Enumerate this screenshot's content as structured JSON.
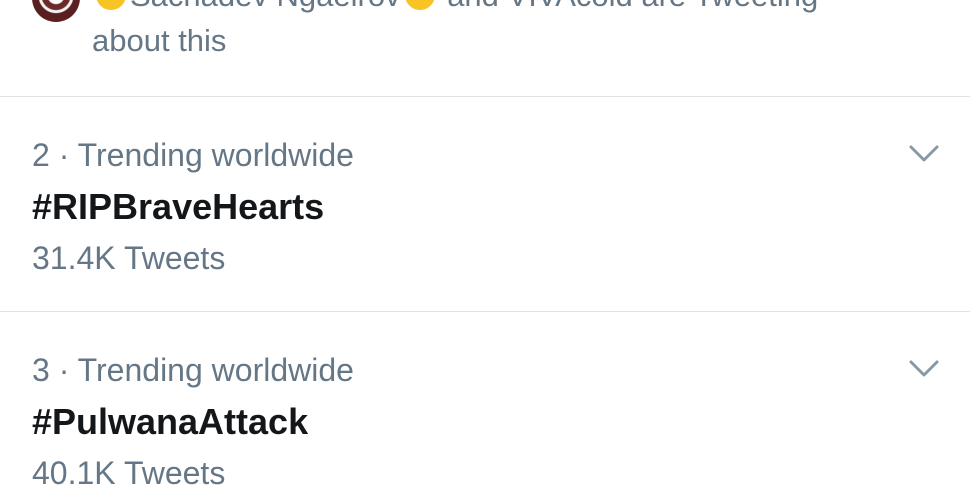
{
  "social_proof": {
    "avatar_icon": "avatar-image",
    "line1_name1": "Sachadev Ngaeirov",
    "line1_suffix": "and VIVAcold are Tweeting",
    "line2": "about this"
  },
  "trends": [
    {
      "rank_label": "2 · Trending worldwide",
      "name": "#RIPBraveHearts",
      "count": "31.4K Tweets",
      "menu_icon": "chevron-down-icon"
    },
    {
      "rank_label": "3 · Trending worldwide",
      "name": "#PulwanaAttack",
      "count": "40.1K Tweets",
      "menu_icon": "chevron-down-icon"
    }
  ],
  "colors": {
    "secondary_text": "#657786",
    "primary_text": "#14171a",
    "divider": "#dfe3e6",
    "emoji": "#f7c325"
  }
}
